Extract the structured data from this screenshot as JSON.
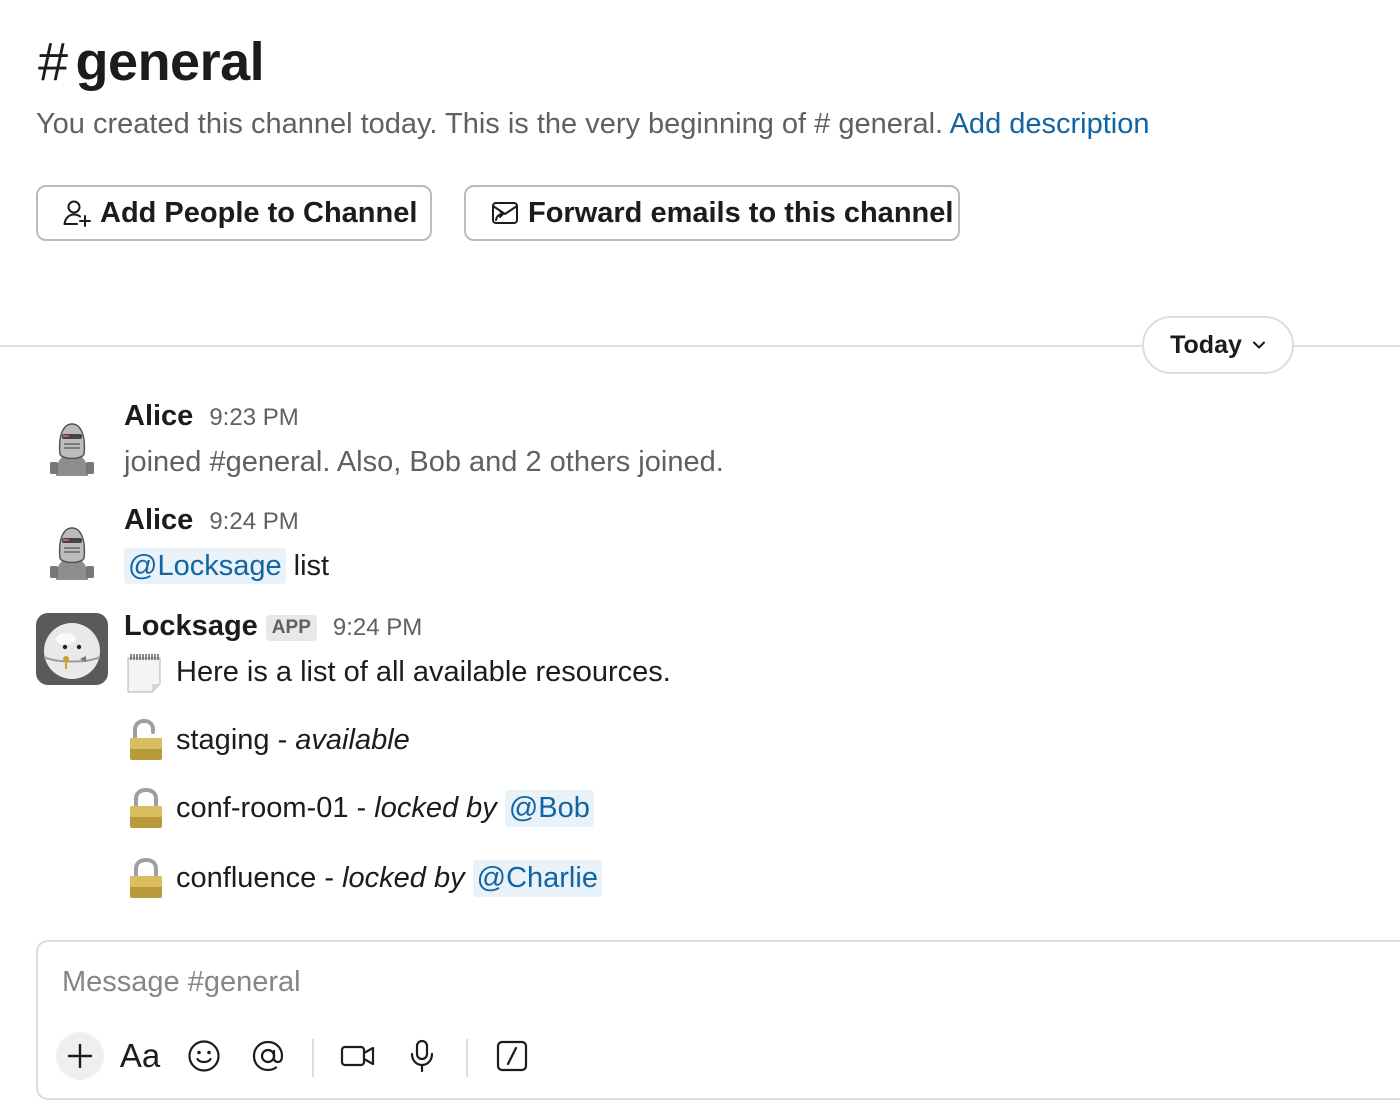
{
  "header": {
    "channel_hash": "#",
    "channel_name": "general",
    "intro_text": "You created this channel today. This is the very beginning of # general.",
    "add_description_link": "Add description",
    "buttons": {
      "add_people": "Add People to Channel",
      "forward_emails": "Forward emails to this channel"
    }
  },
  "divider": {
    "date_label": "Today"
  },
  "messages": [
    {
      "sender": "Alice",
      "time": "9:23 PM",
      "text": "joined #general. Also, Bob and 2 others joined."
    },
    {
      "sender": "Alice",
      "time": "9:24 PM",
      "mention": "@Locksage",
      "text": "list"
    },
    {
      "sender": "Locksage",
      "badge": "APP",
      "time": "9:24 PM",
      "text": "Here is a list of all available resources.",
      "resources": [
        {
          "name": "staging",
          "separator": " - ",
          "status": "available",
          "locked_by": ""
        },
        {
          "name": "conf-room-01",
          "separator": " - ",
          "status": "locked by",
          "locked_by": "@Bob"
        },
        {
          "name": "confluence",
          "separator": " - ",
          "status": "locked by",
          "locked_by": "@Charlie"
        }
      ]
    }
  ],
  "composer": {
    "placeholder": "Message #general",
    "format_label": "Aa"
  },
  "icons": {
    "add_people": "user-plus-icon",
    "forward_emails": "email-forward-icon",
    "date_dropdown": "chevron-down-icon",
    "resource_list": "spiral-notepad-icon",
    "available": "unlocked-padlock-icon",
    "locked": "locked-padlock-icon"
  },
  "colors": {
    "link": "#1264a3",
    "mention_bg": "#e8f2f8",
    "muted_text": "#616061",
    "border": "#dddddd"
  }
}
